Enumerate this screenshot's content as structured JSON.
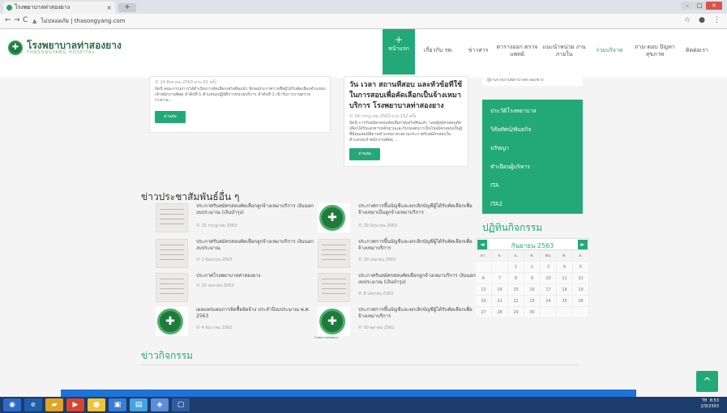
{
  "browser": {
    "tab_title": "โรงพยาบาลท่าสองยาง",
    "tab_close": "×",
    "new_tab": "+",
    "security_label": "ไม่ปลอดภัย",
    "url": "thasongyang.com"
  },
  "site": {
    "name": "โรงพยาบาลท่าสองยาง",
    "sub": "THASONGYANG HOSPITAL",
    "logo_glyph": "✚"
  },
  "nav": {
    "home_glyph": "+",
    "items": [
      {
        "label": "หน้าแรก"
      },
      {
        "label": "เกี่ยวกับ รพ."
      },
      {
        "label": "ข่าวสาร"
      },
      {
        "label": "ตารางออก ตรวจแพทย์"
      },
      {
        "label": "แนะนำหน่วย งานภายใน"
      },
      {
        "label": "ร่วมบริจาค"
      },
      {
        "label": "ถาม-ตอบ ปัญหาสุขภาพ"
      },
      {
        "label": "ติดต่อเรา"
      }
    ]
  },
  "top_cards": {
    "left": {
      "date": "© 24 สิงหาคม 2563 อ่าน 91 ครั้ง",
      "excerpt": "บัดนี้ คณะกรรมการได้ดำเนินการคัดเลือกเสร็จสิ้นแล้ว จึงขอประกาศรายชื่อผู้ได้รับคัดเลือกตำแหน่งเจ้าพนักงานพัสดุ ลำดับที่ 1 ตำแหน่งปฏิบัติการหน่วยบริการ ลำดับที่ 1 เข้ารับการงานตรวจร่างกาย...",
      "button": "อ่านต่อ"
    },
    "middle": {
      "title": "วัน เวลา สถานที่สอบ และหัวข้อที่ใช้ในการสอบเพื่อคัดเลือกเป็นจ้างเหมาบริการ โรงพยาบาลท่าสองยาง",
      "date": "© 24 กรกฎาคม 2563 อ่าน 152 ครั้ง",
      "excerpt": "บัดนี้ การรับสมัครสอบคัดเลือกได้เสร็จสิ้นแล้ว โดยผู้สมัครสอบคัดเลือกได้รับเอกสารหลักฐานและรับรองตนว่าเป็นไปสมัครสอบเป็นผู้ที่มีคุณสมบัติตามตำแหน่ง ตรงตามประกาศรับสมัครสอบในตำแหน่งเจ้าพนักงานพัสดุ ...",
      "button": "อ่านต่อ"
    }
  },
  "pr_section": {
    "title": "ข่าวประชาสัมพันธ์อื่น ๆ",
    "items": [
      {
        "title": "ประกาศรับสมัครสอบคัดเลือกลูกจ้างเหมาบริการ เงินนอกงบประมาณ (เงินบำรุง)",
        "date": "© 15 กรกฎาคม 2563"
      },
      {
        "title": "ประกาศการขึ้นบัญชีและยกเลิกบัญชีผู้ได้รับคัดเลือกเพื่อจ้างเหมาเป็นลูกจ้างเหมาบริการ",
        "date": "© 29 มิถุนายน 2563"
      },
      {
        "title": "ประกาศรับสมัครสอบคัดเลือกลูกจ้างเหมาบริการ เงินนอกงบประมาณ",
        "date": "© 1 มิถุนายน 2563"
      },
      {
        "title": "ประกาศการขึ้นบัญชีและยกเลิกบัญชีผู้ได้รับคัดเลือกเพื่อจ้างเหมาบริการ",
        "date": "© 30 เมษายน 2563"
      },
      {
        "title": "ประกาศโรงพยาบาลท่าสองยาง",
        "date": "© 23 เมษายน 2563"
      },
      {
        "title": "ประกาศรับสมัครสอบคัดเลือกลูกจ้างเหมาบริการ เงินนอกงบประมาณ (เงินบำรุง)",
        "date": "© 8 เมษายน 2563"
      },
      {
        "title": "เผยแพร่แผนการจัดซื้อจัดจ้าง ประจำปีงบประมาณ พ.ศ. 2563",
        "date": "© 4 ธันวาคม 2562"
      },
      {
        "title": "ประกาศการขึ้นบัญชีและยกเลิกบัญชีผู้ได้รับคัดเลือกเพื่อจ้างเหมาบริการ",
        "date": "© 30 ตุลาคม 2562"
      }
    ],
    "emblem_glyph": "✚",
    "emblem_caption": "โรงพยาบาลท่าสองยาง"
  },
  "sidebar": {
    "top_text": "ผู้ยามรายงาบพยาบาลทาสองยาง",
    "menu": [
      {
        "label": "ประวัติโรงพยาบาล"
      },
      {
        "label": "วิสัยทัศน์/พันธกิจ"
      },
      {
        "label": "ปรัชญา"
      },
      {
        "label": "ทำเนียบผู้บริหาร"
      },
      {
        "label": "ITA"
      },
      {
        "label": "ITA2"
      }
    ]
  },
  "calendar": {
    "title": "ปฏิทินกิจกรรม",
    "month": "กันยายน 2563",
    "prev": "◄",
    "next": "►",
    "weekdays": [
      "อา.",
      "จ.",
      "อ.",
      "พ.",
      "พฤ.",
      "ศ.",
      "ส."
    ],
    "cells": [
      "",
      "",
      "1",
      "2",
      "3",
      "4",
      "5",
      "6",
      "7",
      "8",
      "9",
      "10",
      "11",
      "12",
      "13",
      "14",
      "15",
      "16",
      "17",
      "18",
      "19",
      "20",
      "21",
      "22",
      "23",
      "24",
      "25",
      "26",
      "27",
      "28",
      "29",
      "30",
      "",
      "",
      ""
    ]
  },
  "activity": {
    "title": "ข่าวกิจกรรม"
  },
  "scroll_up": "^",
  "taskbar": {
    "time": "8:53",
    "date": "2/9/2563",
    "lang": "TH"
  }
}
